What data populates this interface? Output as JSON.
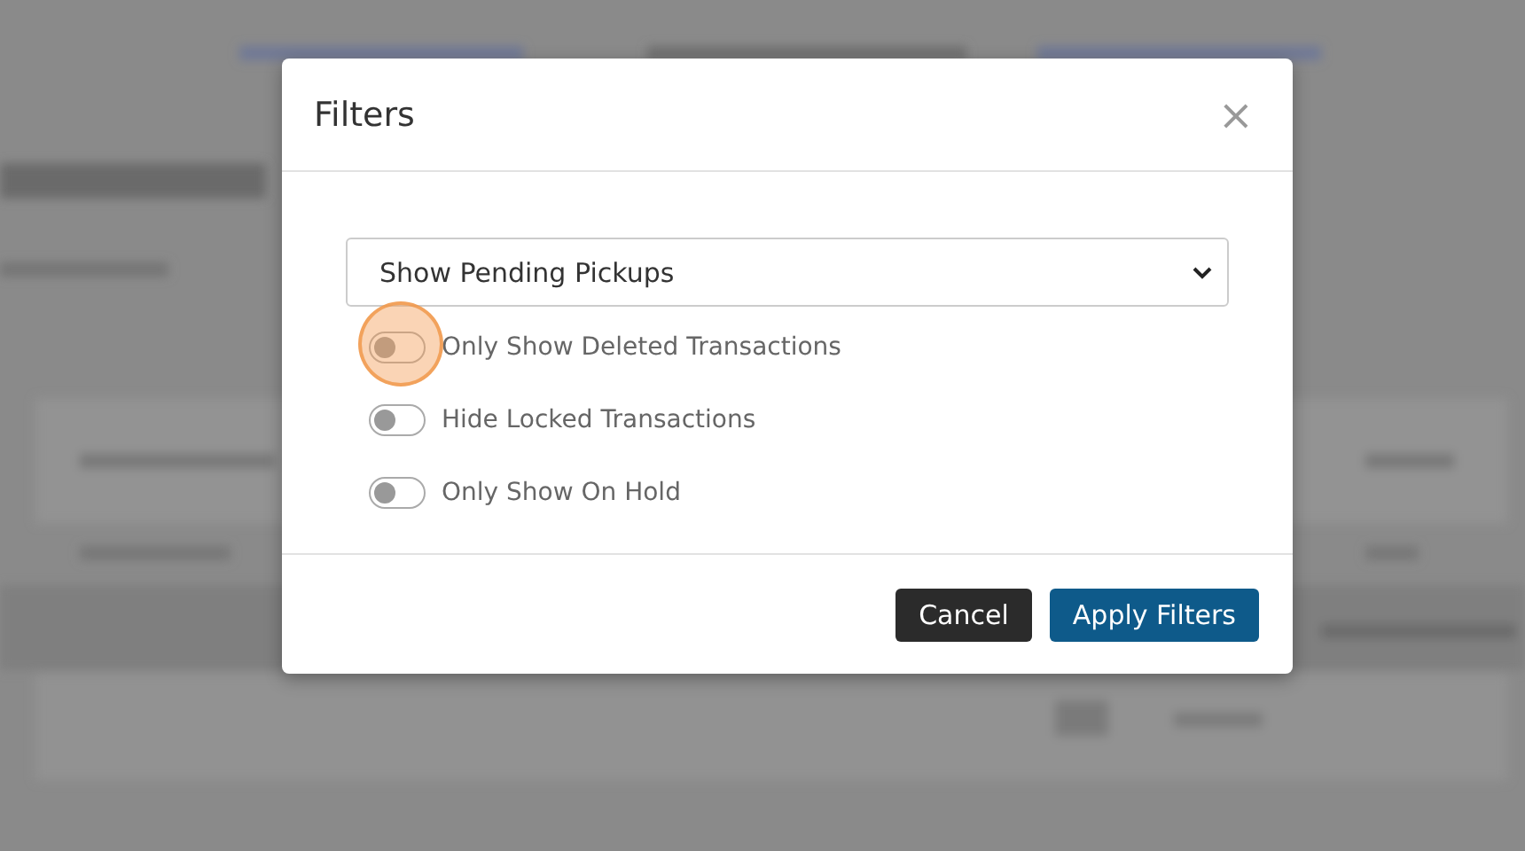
{
  "dialog": {
    "title": "Filters",
    "close": "×",
    "select": {
      "value": "Show Pending Pickups"
    },
    "toggles": [
      {
        "label": "Only Show Deleted Transactions",
        "on": false,
        "highlighted": true
      },
      {
        "label": "Hide Locked Transactions",
        "on": false,
        "highlighted": false
      },
      {
        "label": "Only Show On Hold",
        "on": false,
        "highlighted": false
      }
    ],
    "buttons": [
      {
        "label": "Cancel",
        "kind": "secondary"
      },
      {
        "label": "Apply Filters",
        "kind": "primary"
      }
    ]
  }
}
